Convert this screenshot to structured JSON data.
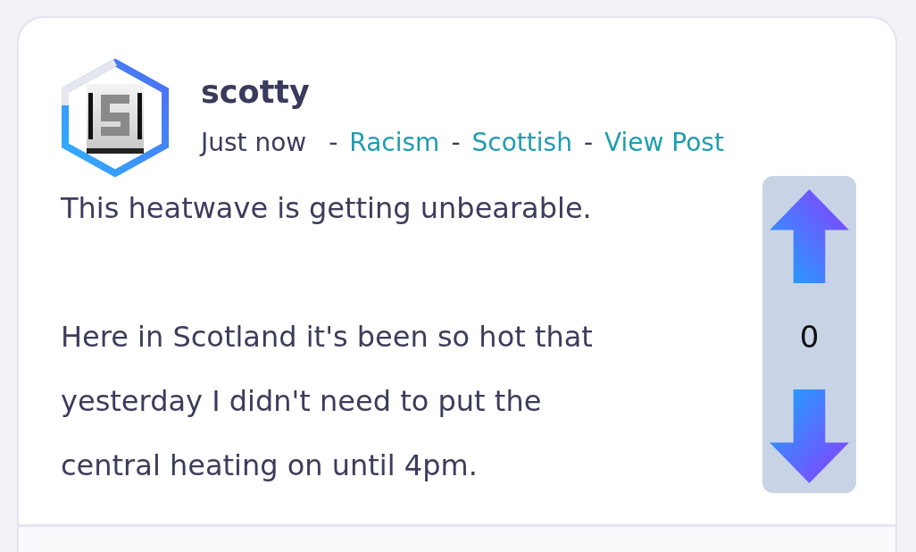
{
  "post": {
    "author": {
      "name": "scotty"
    },
    "meta": [
      {
        "kind": "time",
        "text": "Just now"
      },
      {
        "kind": "separator",
        "text": "-"
      },
      {
        "kind": "tag",
        "text": "Racism"
      },
      {
        "kind": "separator",
        "text": "-"
      },
      {
        "kind": "tag",
        "text": "Scottish"
      },
      {
        "kind": "separator",
        "text": "-"
      },
      {
        "kind": "link",
        "text": "View Post"
      }
    ],
    "body": [
      "This heatwave is getting unbearable.",
      "Here in Scotland it's been so hot that yesterday I didn't need to put the central heating on until 4pm."
    ],
    "votes": {
      "score": "0"
    }
  }
}
